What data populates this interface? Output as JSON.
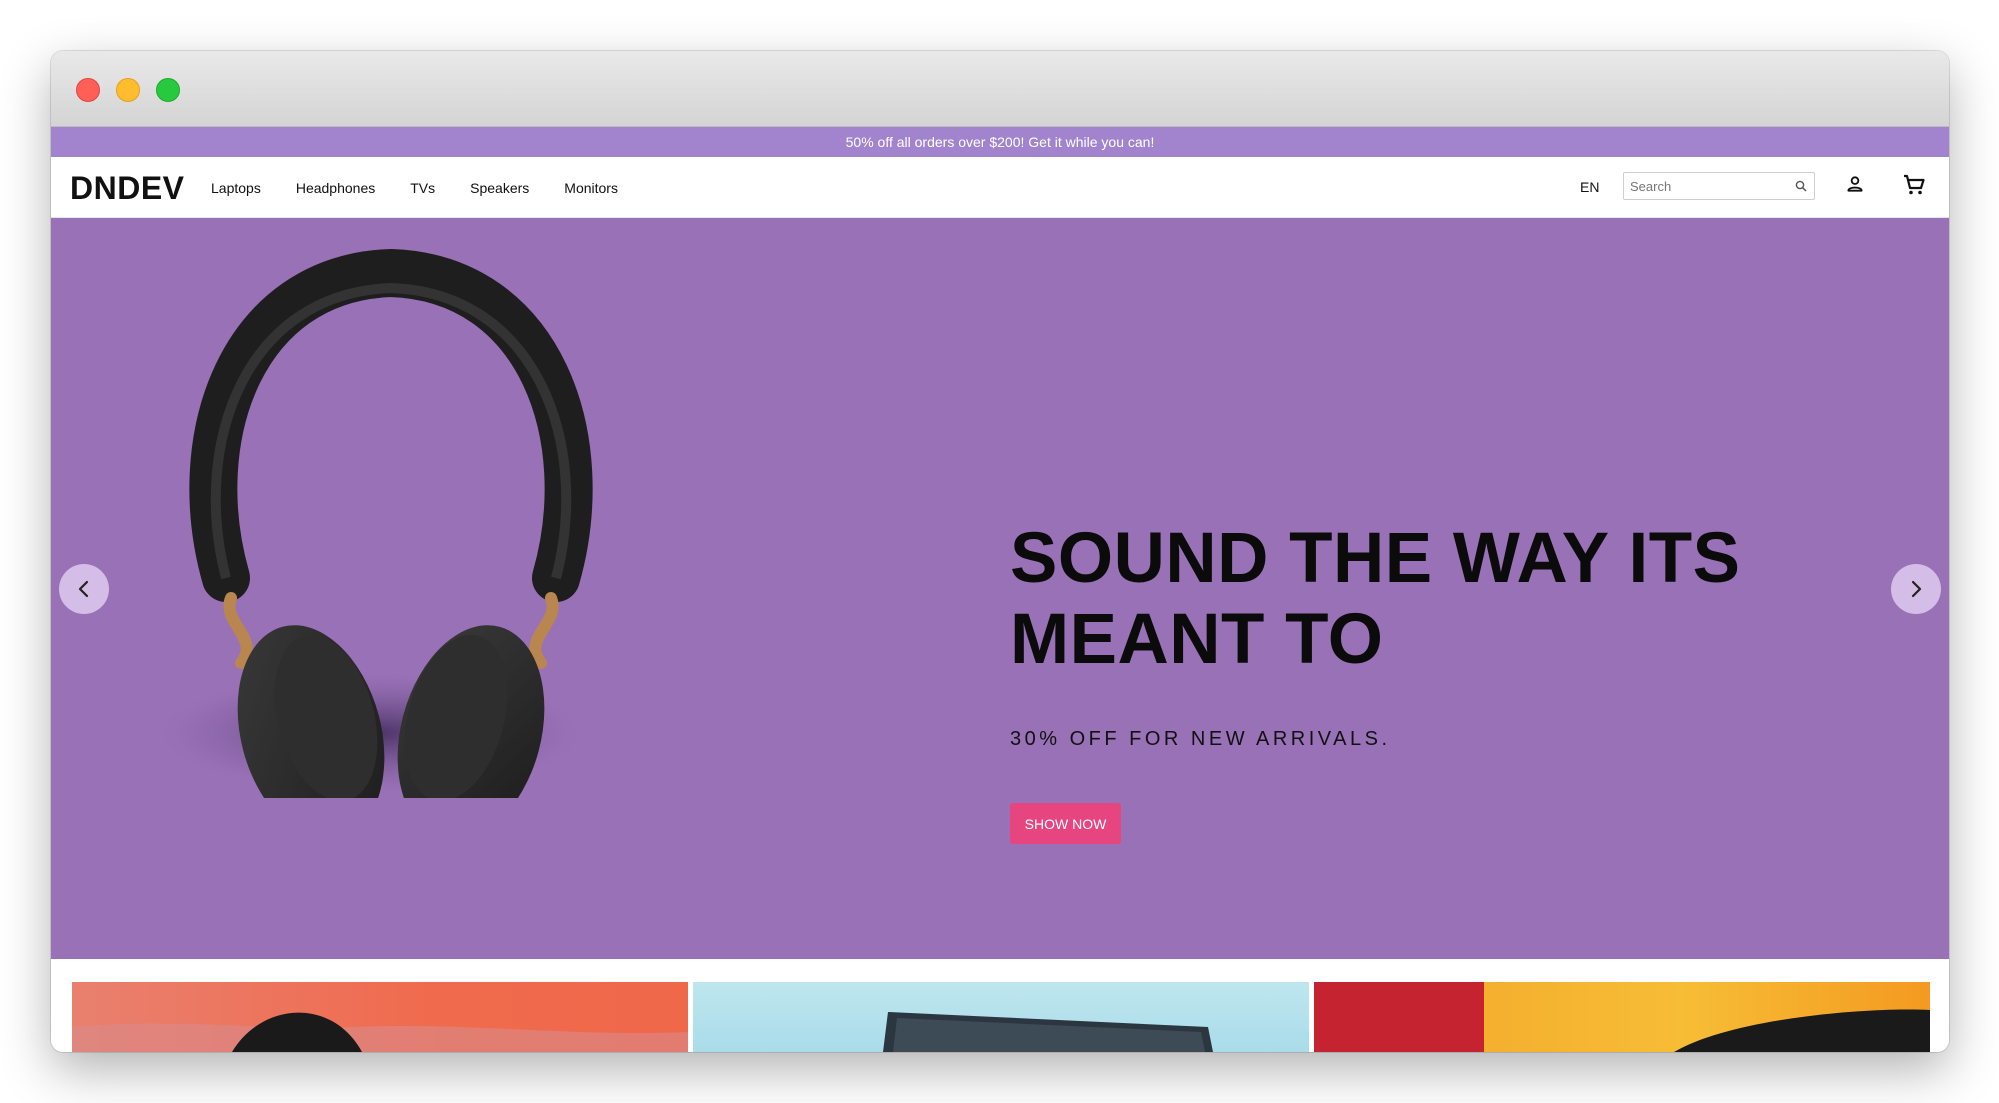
{
  "window": {
    "controls": [
      "close",
      "minimize",
      "maximize"
    ]
  },
  "promo": {
    "text": "50% off all orders over $200! Get it while you can!"
  },
  "header": {
    "logo": "DNDEV",
    "nav": [
      {
        "label": "Laptops"
      },
      {
        "label": "Headphones"
      },
      {
        "label": "TVs"
      },
      {
        "label": "Speakers"
      },
      {
        "label": "Monitors"
      }
    ],
    "language": "EN",
    "search": {
      "placeholder": "Search",
      "value": ""
    },
    "icons": [
      "search-icon",
      "user-icon",
      "cart-icon"
    ]
  },
  "hero": {
    "title_line1": "SOUND THE WAY ITS",
    "title_line2": "MEANT TO",
    "subtitle": "30% OFF FOR NEW ARRIVALS.",
    "button": "SHOW NOW",
    "image": "headphones",
    "icons": [
      "chevron-left-icon",
      "chevron-right-icon"
    ]
  },
  "categories": {
    "cards": [
      "headphones-card-image",
      "laptop-card-image",
      "speaker-card-image"
    ]
  },
  "colors": {
    "promo_bg": "#a184cd",
    "hero_bg": "#9971b7",
    "button_bg": "#e7457f",
    "arrow_bg": "#d4bde6"
  }
}
